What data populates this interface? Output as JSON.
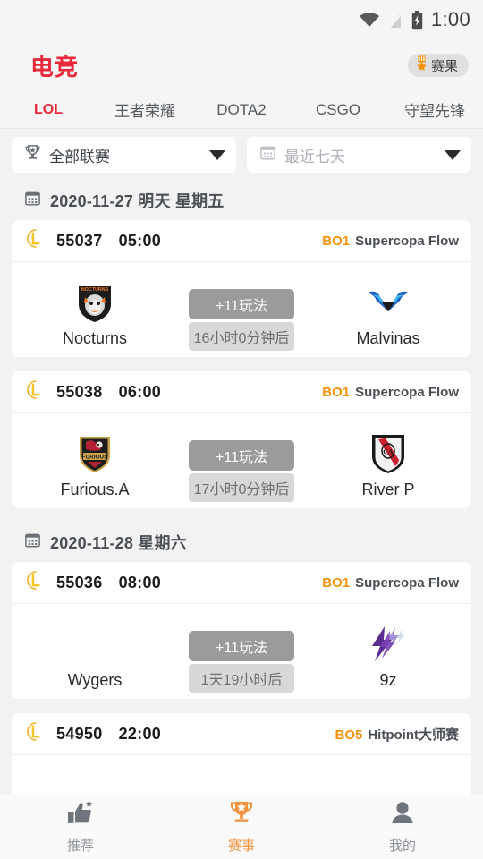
{
  "statusbar": {
    "time": "1:00",
    "wifi_icon": "wifi-icon",
    "signal_icon": "signal-off-icon",
    "battery_icon": "battery-charging-icon"
  },
  "header": {
    "app_title": "电竞",
    "accent_color": "#e8293b",
    "result_badge": {
      "label": "赛果",
      "icon": "medal-icon",
      "icon_color": "#f5920b"
    }
  },
  "tabs": [
    {
      "label": "LOL",
      "active": true
    },
    {
      "label": "王者荣耀",
      "active": false
    },
    {
      "label": "DOTA2",
      "active": false
    },
    {
      "label": "CSGO",
      "active": false
    },
    {
      "label": "守望先锋",
      "active": false
    }
  ],
  "filters": [
    {
      "name": "league-filter",
      "icon": "trophy-icon",
      "value": "全部联赛",
      "is_placeholder": false
    },
    {
      "name": "date-filter",
      "icon": "calendar-icon",
      "value": "最近七天",
      "is_placeholder": true
    }
  ],
  "sections": [
    {
      "date_label": "2020-11-27 明天 星期五",
      "matches": [
        {
          "id": "55037",
          "time": "05:00",
          "bo": "BO1",
          "league": "Supercopa Flow",
          "play_label": "+11玩法",
          "countdown": "16小时0分钟后",
          "home": {
            "name": "Nocturns",
            "logo": "nocturns-logo"
          },
          "away": {
            "name": "Malvinas",
            "logo": "malvinas-logo"
          }
        },
        {
          "id": "55038",
          "time": "06:00",
          "bo": "BO1",
          "league": "Supercopa Flow",
          "play_label": "+11玩法",
          "countdown": "17小时0分钟后",
          "home": {
            "name": "Furious.A",
            "logo": "furious-logo"
          },
          "away": {
            "name": "River P",
            "logo": "riverplate-logo"
          }
        }
      ]
    },
    {
      "date_label": "2020-11-28 星期六",
      "matches": [
        {
          "id": "55036",
          "time": "08:00",
          "bo": "BO1",
          "league": "Supercopa Flow",
          "play_label": "+11玩法",
          "countdown": "1天19小时后",
          "home": {
            "name": "Wygers",
            "logo": "none"
          },
          "away": {
            "name": "9z",
            "logo": "ninez-logo"
          }
        },
        {
          "id": "54950",
          "time": "22:00",
          "bo": "BO5",
          "league": "Hitpoint大师赛",
          "play_label": "",
          "countdown": "",
          "home": {
            "name": "",
            "logo": "none"
          },
          "away": {
            "name": "",
            "logo": "none"
          }
        }
      ]
    }
  ],
  "bottomnav": [
    {
      "label": "推荐",
      "icon": "thumbs-up-star-icon",
      "active": false
    },
    {
      "label": "赛事",
      "icon": "trophy-star-icon",
      "active": true
    },
    {
      "label": "我的",
      "icon": "person-icon",
      "active": false
    }
  ]
}
